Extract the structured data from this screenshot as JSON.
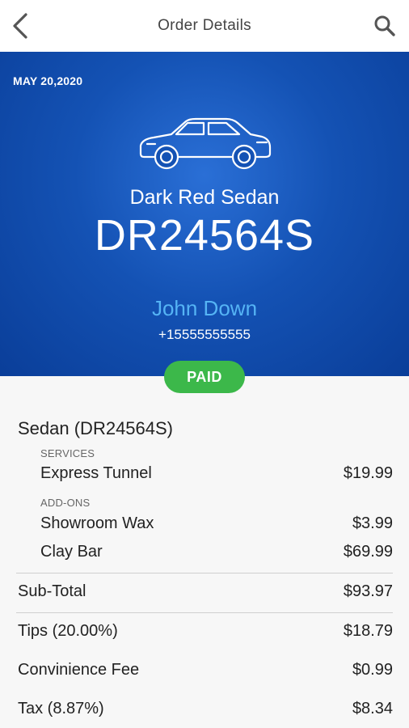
{
  "header": {
    "title": "Order Details"
  },
  "hero": {
    "date": "MAY 20,2020",
    "model": "Dark Red Sedan",
    "plate": "DR24564S",
    "customer_name": "John Down",
    "phone": "+15555555555",
    "status": "PAID"
  },
  "order": {
    "vehicle": "Sedan (DR24564S)",
    "services_header": "SERVICES",
    "services": [
      {
        "label": "Express Tunnel",
        "amount": "$19.99"
      }
    ],
    "addons_header": "ADD-ONS",
    "addons": [
      {
        "label": "Showroom Wax",
        "amount": "$3.99"
      },
      {
        "label": "Clay Bar",
        "amount": "$69.99"
      }
    ],
    "subtotal": {
      "label": "Sub-Total",
      "amount": "$93.97"
    },
    "tips": {
      "label": "Tips (20.00%)",
      "amount": "$18.79"
    },
    "fee": {
      "label": "Convinience Fee",
      "amount": "$0.99"
    },
    "tax": {
      "label": "Tax (8.87%)",
      "amount": "$8.34"
    }
  },
  "colors": {
    "hero_blue": "#1452b4",
    "name_blue": "#55b4f5",
    "paid_green": "#3cb84a"
  }
}
